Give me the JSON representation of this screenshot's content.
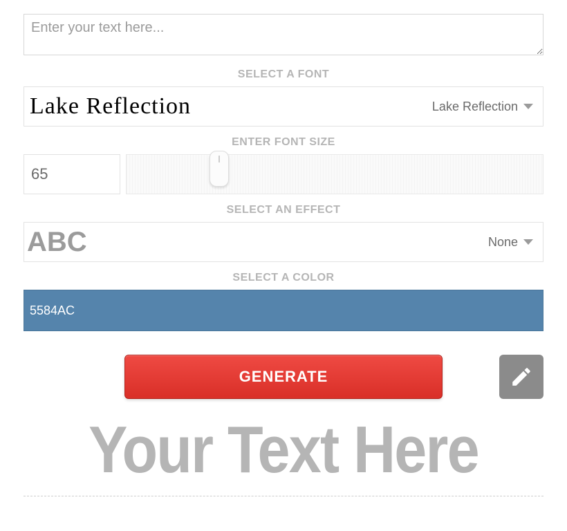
{
  "text_input": {
    "placeholder": "Enter your text here...",
    "value": ""
  },
  "font": {
    "label": "SELECT A FONT",
    "preview_text": "Lake Reflection",
    "selected": "Lake Reflection"
  },
  "font_size": {
    "label": "ENTER FONT SIZE",
    "value": "65"
  },
  "effect": {
    "label": "SELECT AN EFFECT",
    "preview_text": "ABC",
    "selected": "None"
  },
  "color": {
    "label": "SELECT A COLOR",
    "value": "5584AC",
    "hex": "#5584AC"
  },
  "actions": {
    "generate": "GENERATE"
  },
  "preview": {
    "text": "Your Text Here"
  }
}
